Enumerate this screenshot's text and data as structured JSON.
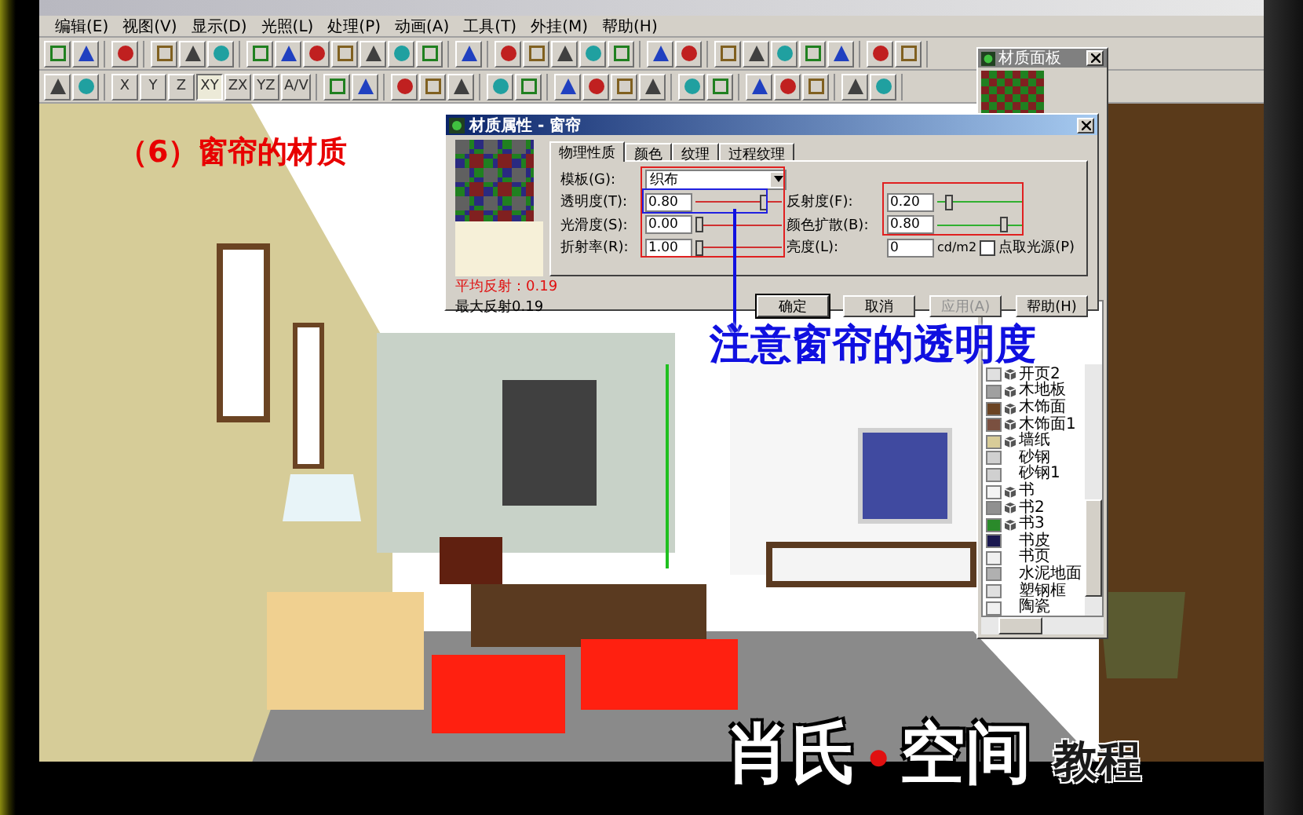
{
  "menu": [
    "编辑(E)",
    "视图(V)",
    "显示(D)",
    "光照(L)",
    "处理(P)",
    "动画(A)",
    "工具(T)",
    "外挂(M)",
    "帮助(H)"
  ],
  "axis_buttons": [
    {
      "label": "X",
      "selected": false
    },
    {
      "label": "Y",
      "selected": false
    },
    {
      "label": "Z",
      "selected": false
    },
    {
      "label": "XY",
      "selected": true
    },
    {
      "label": "ZX",
      "selected": false
    },
    {
      "label": "YZ",
      "selected": false
    },
    {
      "label": "A/V",
      "selected": false
    }
  ],
  "annotation_title": "（6）窗帘的材质",
  "annotation_note": "注意窗帘的透明度",
  "dialog": {
    "title": "材质属性 - 窗帘",
    "tabs": [
      {
        "label": "物理性质",
        "selected": true
      },
      {
        "label": "颜色",
        "selected": false
      },
      {
        "label": "纹理",
        "selected": false
      },
      {
        "label": "过程纹理",
        "selected": false
      }
    ],
    "template_label": "模板(G):",
    "template_value": "织布",
    "left_params": [
      {
        "label": "透明度(T):",
        "value": "0.80",
        "level": 0.82
      },
      {
        "label": "光滑度(S):",
        "value": "0.00",
        "level": 0
      },
      {
        "label": "折射率(R):",
        "value": "1.00",
        "level": 0
      }
    ],
    "right_params": [
      {
        "label": "反射度(F):",
        "value": "0.20",
        "level": 0.1
      },
      {
        "label": "颜色扩散(B):",
        "value": "0.80",
        "level": 0.8
      }
    ],
    "brightness": {
      "label": "亮度(L):",
      "value": "0",
      "unit": "cd/m2"
    },
    "pick_light": {
      "label": "点取光源(P)",
      "checked": false
    },
    "avg_reflect": "平均反射：0.19",
    "max_reflect": "最大反射0.19",
    "buttons": [
      {
        "label": "确定",
        "disabled": false
      },
      {
        "label": "取消",
        "disabled": false
      },
      {
        "label": "应用(A)",
        "disabled": true
      },
      {
        "label": "帮助(H)",
        "disabled": false
      }
    ]
  },
  "panel": {
    "title": "材质面板",
    "items": [
      {
        "label": "开页2",
        "color": "#e0e0e0",
        "has_icon": true
      },
      {
        "label": "木地板",
        "color": "#a0a0a0",
        "has_icon": true
      },
      {
        "label": "木饰面",
        "color": "#6b4423",
        "has_icon": true
      },
      {
        "label": "木饰面1",
        "color": "#7a5040",
        "has_icon": true
      },
      {
        "label": "墙纸",
        "color": "#d8cc98",
        "has_icon": true
      },
      {
        "label": "砂钢",
        "color": "#d0d0d0",
        "has_icon": false
      },
      {
        "label": "砂钢1",
        "color": "#d0d0d0",
        "has_icon": false
      },
      {
        "label": "书",
        "color": "#f4f4f4",
        "has_icon": true
      },
      {
        "label": "书2",
        "color": "#909090",
        "has_icon": true
      },
      {
        "label": "书3",
        "color": "#2a8a2a",
        "has_icon": true
      },
      {
        "label": "书皮",
        "color": "#1a1850",
        "has_icon": false
      },
      {
        "label": "书页",
        "color": "#f0f0f0",
        "has_icon": false
      },
      {
        "label": "水泥地面",
        "color": "#b0b0b0",
        "has_icon": false
      },
      {
        "label": "塑钢框",
        "color": "#e0e0e0",
        "has_icon": false
      },
      {
        "label": "陶瓷",
        "color": "#f0f0f0",
        "has_icon": false
      }
    ]
  },
  "logo": {
    "title_left": "肖氏",
    "separator": "•",
    "title_right": "空间",
    "subtitle": "教程"
  }
}
